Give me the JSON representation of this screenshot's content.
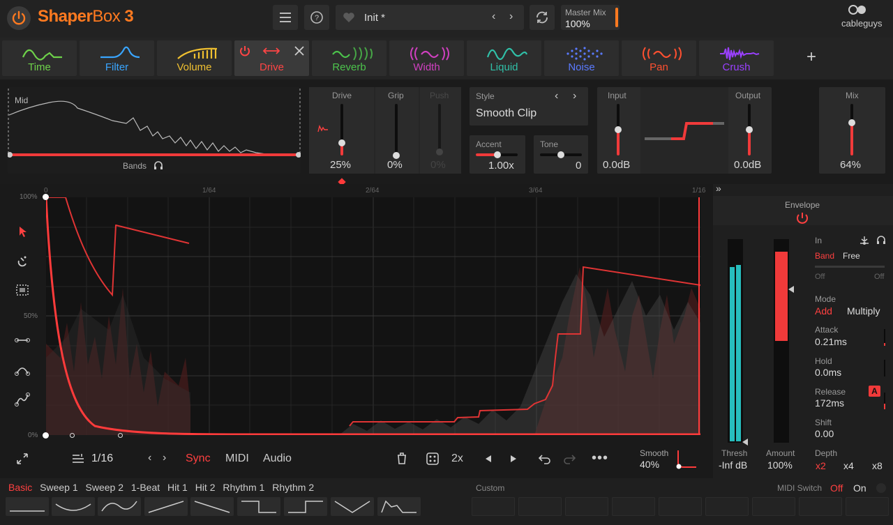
{
  "header": {
    "brand_shaper": "Shaper",
    "brand_box": "Box",
    "brand_version": "3",
    "preset_name": "Init *",
    "master_mix_label": "Master Mix",
    "master_mix_value": "100%",
    "cableguys": "cableguys"
  },
  "tabs": [
    {
      "label": "Time",
      "color": "#6ed24a"
    },
    {
      "label": "Filter",
      "color": "#39a5ff"
    },
    {
      "label": "Volume",
      "color": "#f0c030"
    },
    {
      "label": "Drive",
      "color": "#ff4545"
    },
    {
      "label": "Reverb",
      "color": "#4cc34c"
    },
    {
      "label": "Width",
      "color": "#d040c0"
    },
    {
      "label": "Liquid",
      "color": "#30c0a8"
    },
    {
      "label": "Noise",
      "color": "#5a7aff"
    },
    {
      "label": "Pan",
      "color": "#ff5030"
    },
    {
      "label": "Crush",
      "color": "#9a40ff"
    }
  ],
  "add_tab": "+",
  "drive": {
    "bands_label": "Mid",
    "bands_footer": "Bands",
    "drive_label": "Drive",
    "drive_value": "25%",
    "drive_level": 0.25,
    "grip_label": "Grip",
    "grip_value": "0%",
    "grip_level": 0,
    "push_label": "Push",
    "push_value": "0%",
    "style_label": "Style",
    "style_value": "Smooth Clip",
    "accent_label": "Accent",
    "accent_value": "1.00x",
    "tone_label": "Tone",
    "tone_value": "0",
    "input_label": "Input",
    "input_value": "0.0dB",
    "output_label": "Output",
    "output_value": "0.0dB",
    "mix_label": "Mix",
    "mix_value": "64%",
    "mix_level": 0.64
  },
  "graph": {
    "label_100": "100%",
    "label_50": "50%",
    "label_0": "0%",
    "ruler_0": "0",
    "ruler_1": "1/64",
    "ruler_2": "2/64",
    "ruler_3": "3/64",
    "ruler_4": "1/16"
  },
  "toolbar": {
    "grid_value": "1/16",
    "sync": "Sync",
    "midi": "MIDI",
    "audio": "Audio",
    "zoom": "2x",
    "smooth_label": "Smooth",
    "smooth_value": "40%"
  },
  "envelope": {
    "title": "Envelope",
    "in_label": "In",
    "band": "Band",
    "free": "Free",
    "off_left": "Off",
    "off_right": "Off",
    "mode_label": "Mode",
    "mode_add": "Add",
    "mode_multiply": "Multiply",
    "attack_label": "Attack",
    "attack_value": "0.21ms",
    "hold_label": "Hold",
    "hold_value": "0.0ms",
    "release_label": "Release",
    "release_value": "172ms",
    "release_badge": "A",
    "shift_label": "Shift",
    "shift_value": "0.00",
    "thresh_label": "Thresh",
    "thresh_value": "-Inf dB",
    "amount_label": "Amount",
    "amount_value": "100%",
    "depth_label": "Depth",
    "depth_x2": "x2",
    "depth_x4": "x4",
    "depth_x8": "x8"
  },
  "presets": {
    "tabs": [
      "Basic",
      "Sweep 1",
      "Sweep 2",
      "1-Beat",
      "Hit 1",
      "Hit 2",
      "Rhythm 1",
      "Rhythm 2"
    ],
    "custom_label": "Custom",
    "midi_switch_label": "MIDI Switch",
    "midi_off": "Off",
    "midi_on": "On"
  }
}
